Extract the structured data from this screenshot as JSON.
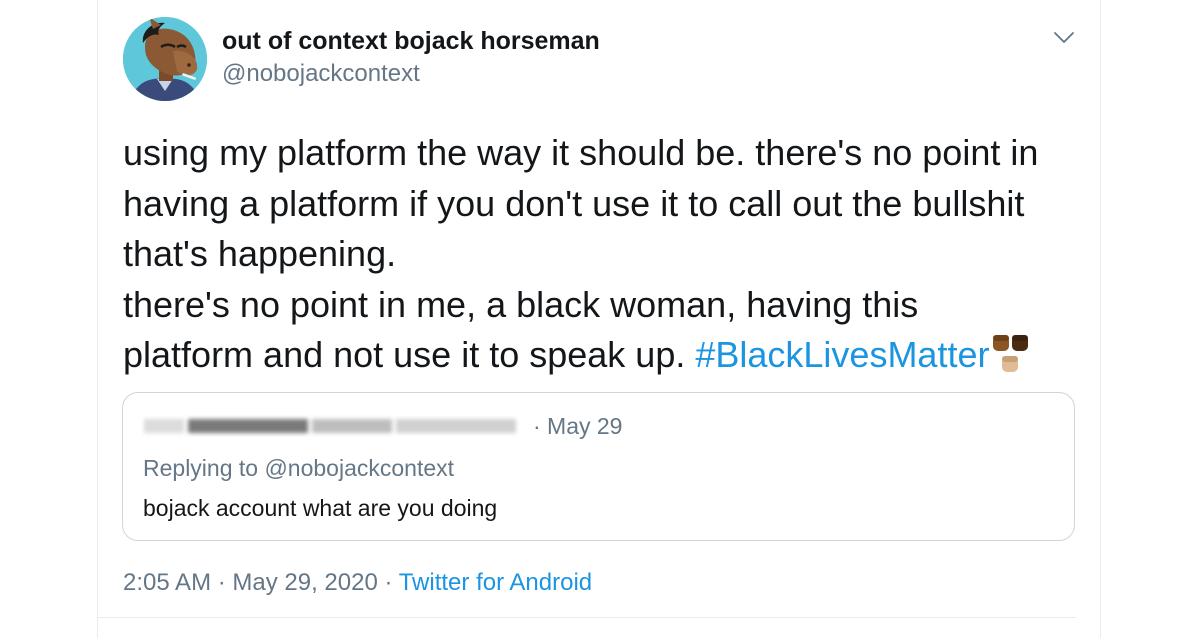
{
  "author": {
    "display_name": "out of context bojack horseman",
    "handle": "@nobojackcontext"
  },
  "tweet": {
    "lines": [
      "using my platform the way it should be. there's no point in",
      "having a platform if you don't use it to call out the bullshit",
      "that's happening.",
      "there's no point in me, a black woman, having this"
    ],
    "last_line_text": "platform and not use it to speak up. ",
    "hashtag": "#BlackLivesMatter",
    "emoji": "✊🏾✊🏿✊🏼"
  },
  "quoted_tweet": {
    "date": "· May 29",
    "replying_to": "Replying to @nobojackcontext",
    "text": "bojack account what are you doing"
  },
  "meta": {
    "time": "2:05 AM · May 29, 2020 · ",
    "source": "Twitter for Android"
  },
  "colors": {
    "link": "#1b95e0",
    "secondary_text": "#657786",
    "primary_text": "#14171a",
    "border": "#ccd6dd"
  },
  "icons": {
    "caret": "chevron-down-icon",
    "avatar": "bojack-horseman-avatar"
  }
}
